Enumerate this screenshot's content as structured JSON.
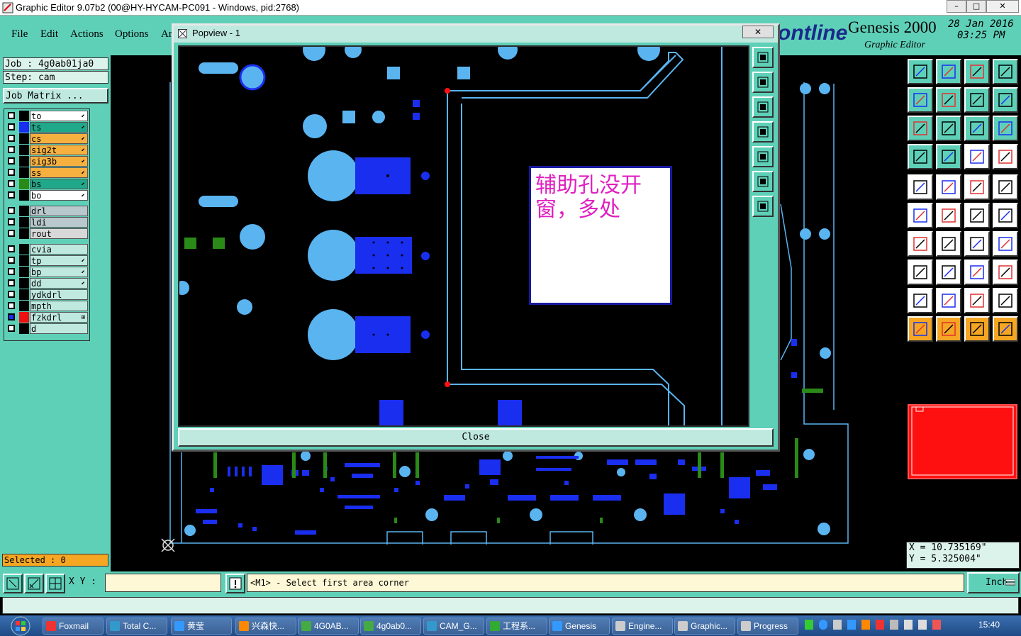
{
  "window": {
    "title": "Graphic Editor 9.07b2 (00@HY-HYCAM-PC091 - Windows, pid:2768)",
    "min": "–",
    "max": "□",
    "close": "✕"
  },
  "menu": [
    "File",
    "Edit",
    "Actions",
    "Options",
    "Ar"
  ],
  "brand": {
    "logo": "ontline",
    "product": "Genesis 2000",
    "subtitle": "Graphic Editor",
    "date": "28 Jan 2016",
    "time": "03:25 PM"
  },
  "job": {
    "job_label": "Job  : 4g0ab01ja0",
    "step_label": "Step: cam",
    "matrix_button": "Job Matrix ..."
  },
  "layers": [
    {
      "name": "to",
      "color": "#000000",
      "bg": "#ffffff",
      "mark": "⬋",
      "checked": false
    },
    {
      "name": "ts",
      "color": "#1a2ef0",
      "bg": "#1fa88a",
      "mark": "⬋",
      "checked": false
    },
    {
      "name": "cs",
      "color": "#000000",
      "bg": "#f5b040",
      "mark": "⬋",
      "checked": false
    },
    {
      "name": "sig2t",
      "color": "#000000",
      "bg": "#f5b040",
      "mark": "⬋",
      "checked": false
    },
    {
      "name": "sig3b",
      "color": "#000000",
      "bg": "#f5b040",
      "mark": "⬋",
      "checked": false
    },
    {
      "name": "ss",
      "color": "#000000",
      "bg": "#f5b040",
      "mark": "⬋",
      "checked": false
    },
    {
      "name": "bs",
      "color": "#2a8a18",
      "bg": "#1fa88a",
      "mark": "⬋",
      "checked": false
    },
    {
      "name": "bo",
      "color": "#000000",
      "bg": "#ffffff",
      "mark": "⬋",
      "checked": false
    },
    {
      "name": "drl",
      "color": "#000000",
      "bg": "#b8c8cc",
      "mark": "",
      "checked": false
    },
    {
      "name": "ldi",
      "color": "#000000",
      "bg": "#b8c8cc",
      "mark": "",
      "checked": false
    },
    {
      "name": "rout",
      "color": "#000000",
      "bg": "#d8d8d8",
      "mark": "",
      "checked": false
    },
    {
      "name": "cvia",
      "color": "#000000",
      "bg": "#bfe9df",
      "mark": "",
      "checked": false
    },
    {
      "name": "tp",
      "color": "#000000",
      "bg": "#bfe9df",
      "mark": "⬋",
      "checked": false
    },
    {
      "name": "bp",
      "color": "#000000",
      "bg": "#bfe9df",
      "mark": "⬋",
      "checked": false
    },
    {
      "name": "dd",
      "color": "#000000",
      "bg": "#bfe9df",
      "mark": "⬋",
      "checked": false
    },
    {
      "name": "ydkdrl",
      "color": "#000000",
      "bg": "#bfe9df",
      "mark": "",
      "checked": false
    },
    {
      "name": "mpth",
      "color": "#000000",
      "bg": "#bfe9df",
      "mark": "",
      "checked": false
    },
    {
      "name": "fzkdrl",
      "color": "#ee1111",
      "bg": "#bfe9df",
      "mark": "⊞",
      "checked": true
    },
    {
      "name": "d",
      "color": "#000000",
      "bg": "#bfe9df",
      "mark": "",
      "checked": false
    }
  ],
  "selected_label": "Selected : 0",
  "popup": {
    "title": "Popview - 1",
    "close_x": "✕",
    "close_button": "Close",
    "note": "辅助孔没开窗，多处"
  },
  "coords": {
    "x": "X  =  10.735169\"",
    "y": "Y  =  5.325004\""
  },
  "bottom": {
    "xy_label": "X Y :",
    "xy_value": "",
    "message": "<M1> - Select first area corner",
    "unit": "Inch"
  },
  "taskbar": {
    "tasks": [
      "Foxmail",
      "Total C...",
      "黄莹",
      "兴森快...",
      "4G0AB...",
      "4g0ab0...",
      "CAM_G...",
      "工程系...",
      "Genesis",
      "Engine...",
      "Graphic...",
      "Progress"
    ],
    "clock": "15:40"
  },
  "colors": {
    "panel": "#5fd0b8",
    "pad": "#5ab4f0",
    "trace": "#5ab4f0",
    "smd": "#1a2ef0",
    "accent_red": "#ff1010"
  }
}
